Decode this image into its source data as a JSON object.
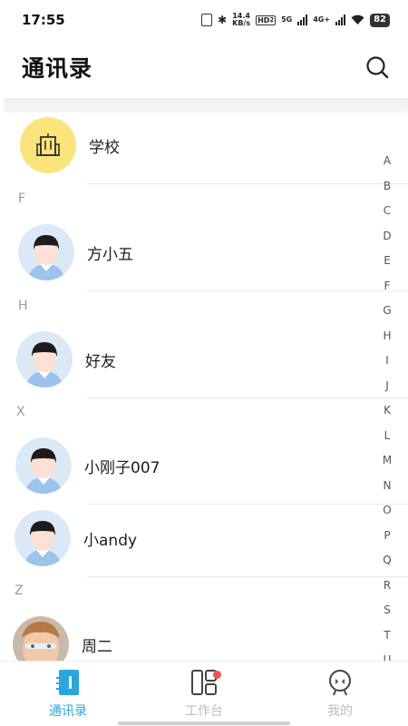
{
  "status_bar": {
    "time": "17:55",
    "speed_value": "14.4",
    "speed_unit": "KB/s",
    "hd_label": "HD",
    "hd_sub": "2",
    "net1": "5G",
    "net2": "4G+",
    "battery": "82"
  },
  "header": {
    "title": "通讯录",
    "search_icon": "search-icon"
  },
  "contacts": {
    "school": {
      "name": "学校",
      "icon": "building-icon"
    },
    "sections": [
      {
        "letter": "F"
      },
      {
        "letter": "H"
      },
      {
        "letter": "X"
      },
      {
        "letter": "Z"
      }
    ],
    "items": [
      {
        "name": "方小五"
      },
      {
        "name": "好友"
      },
      {
        "name": "小刚子007"
      },
      {
        "name": "小andy"
      },
      {
        "name": "周二"
      }
    ]
  },
  "alpha_index": [
    "A",
    "B",
    "C",
    "D",
    "E",
    "F",
    "G",
    "H",
    "I",
    "J",
    "K",
    "L",
    "M",
    "N",
    "O",
    "P",
    "Q",
    "R",
    "S",
    "T",
    "U"
  ],
  "bottom_nav": {
    "items": [
      {
        "label": "通讯录",
        "active": true
      },
      {
        "label": "工作台",
        "has_badge": true
      },
      {
        "label": "我的"
      }
    ]
  },
  "colors": {
    "accent": "#2aa6df",
    "school_bg": "#fbe47c",
    "badge": "#ef5350"
  }
}
